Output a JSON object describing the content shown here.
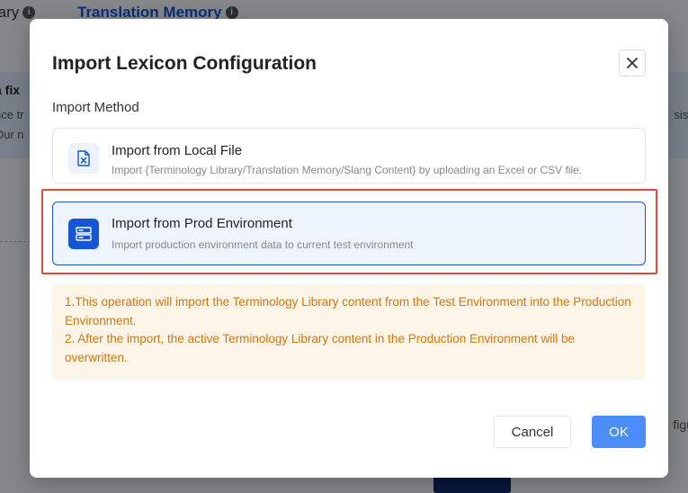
{
  "background": {
    "tab_left_label": "rary",
    "tab_active_label": "Translation Memory",
    "info_glyph": "i",
    "banner_line1": "a fix",
    "banner_line2": "nce tr",
    "banner_line3": "Our n",
    "banner_right": "sist",
    "right_label": "figu"
  },
  "modal": {
    "title": "Import Lexicon Configuration",
    "close_icon": "close-icon",
    "method_label": "Import Method",
    "options": [
      {
        "title": "Import from Local File",
        "description": "Import {Terminology Library/Translation Memory/Slang Content} by uploading an Excel or CSV file.",
        "icon": "excel-file-icon",
        "selected": false
      },
      {
        "title": "Import from Prod Environment",
        "description": "Import production environment data to current test environment",
        "icon": "server-icon",
        "selected": true
      }
    ],
    "warning": {
      "line1": "1.This operation will import the Terminology Library content from the Test Environment into the Production Environment.",
      "line2": "2. After the import, the active Terminology Library content in the Production Environment will be overwritten."
    },
    "cancel_label": "Cancel",
    "ok_label": "OK"
  },
  "colors": {
    "accent": "#1456d6",
    "ok_button": "#4b8ef7",
    "warning_text": "#d3760f",
    "warning_bg": "#fdf6e8",
    "highlight": "#e04a3f"
  }
}
